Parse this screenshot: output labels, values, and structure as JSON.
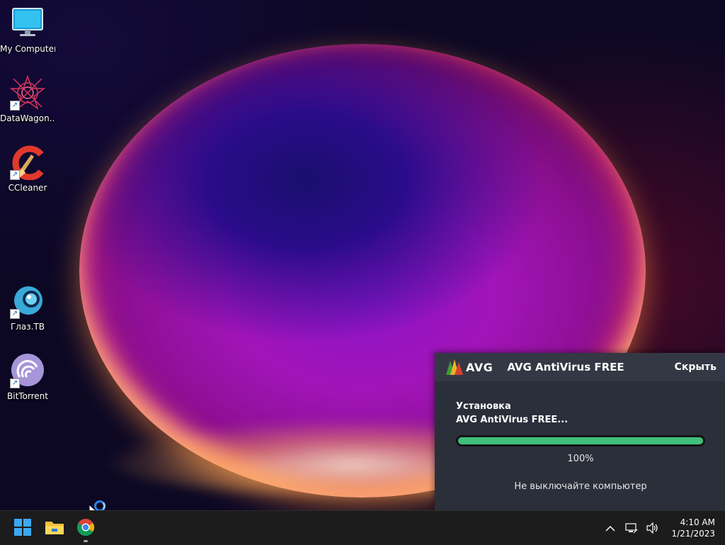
{
  "desktop": {
    "icons": [
      {
        "label": "My Computer",
        "icon": "monitor-icon"
      },
      {
        "label": "DataWagon...",
        "icon": "datawagon-icon"
      },
      {
        "label": "CCleaner",
        "icon": "ccleaner-icon"
      },
      {
        "label": "Глаз.ТВ",
        "icon": "glaz-tv-icon"
      },
      {
        "label": "BitTorrent",
        "icon": "bittorrent-icon"
      }
    ]
  },
  "avg": {
    "logo_text": "AVG",
    "title": "AVG AntiVirus FREE",
    "hide_label": "Скрыть",
    "status_line1": "Установка",
    "status_line2": "AVG AntiVirus FREE...",
    "progress_percent": 100,
    "progress_label": "100%",
    "warning": "Не выключайте компьютер",
    "accent_color": "#3fbf79"
  },
  "taskbar": {
    "apps": [
      {
        "name": "start-button",
        "icon": "windows-icon"
      },
      {
        "name": "file-explorer",
        "icon": "folder-icon"
      },
      {
        "name": "chrome",
        "icon": "chrome-icon"
      }
    ],
    "tray": {
      "chevron": "chevron-up-icon",
      "network": "network-icon",
      "volume": "speaker-icon"
    },
    "clock": {
      "time": "4:10 AM",
      "date": "1/21/2023"
    }
  }
}
